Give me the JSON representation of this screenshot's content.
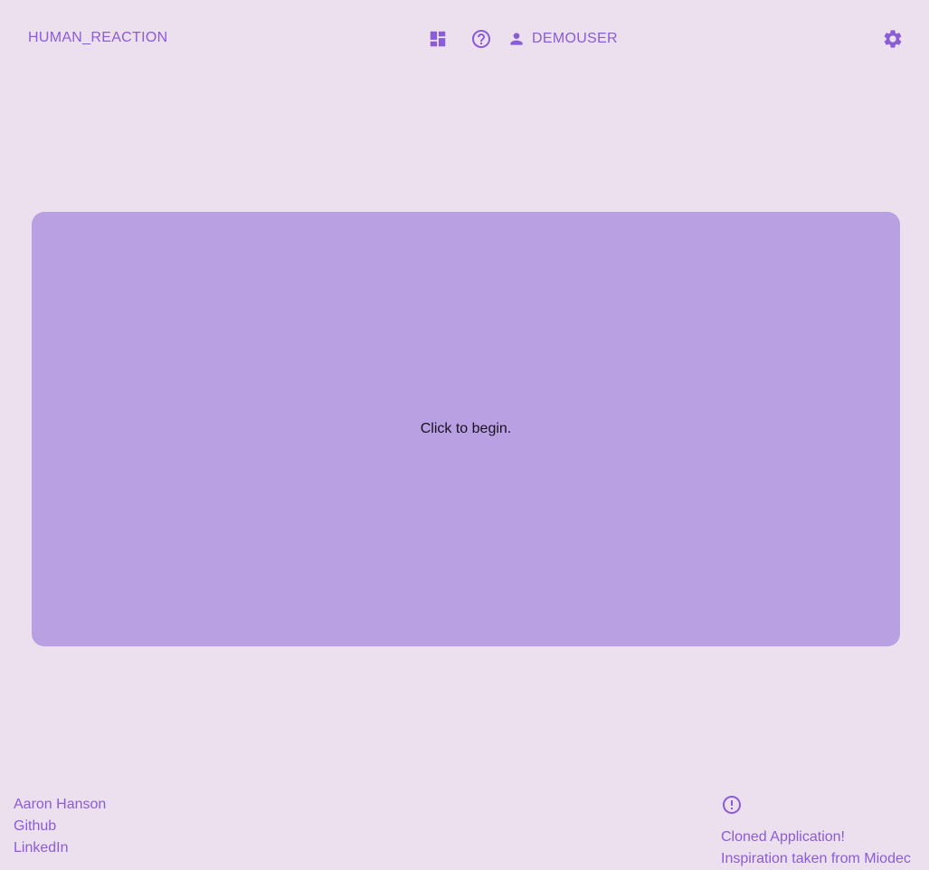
{
  "header": {
    "brand": "HUMAN_REACTION",
    "icons": {
      "dashboard": "dashboard-icon",
      "help": "help-circle-icon",
      "user": "person-icon",
      "settings": "gear-icon"
    },
    "username": "DEMOUSER"
  },
  "main": {
    "prompt": "Click to begin."
  },
  "footer": {
    "left": {
      "name": "Aaron Hanson",
      "github": "Github",
      "linkedin": "LinkedIn"
    },
    "right": {
      "icon": "alert-circle-icon",
      "line1": "Cloned Application!",
      "line2": "Inspiration taken from Miodec"
    }
  },
  "colors": {
    "background": "#ede0ee",
    "accent": "#8a5cd6",
    "test_area": "#b9a0e2",
    "prompt_text": "#1a1020"
  }
}
